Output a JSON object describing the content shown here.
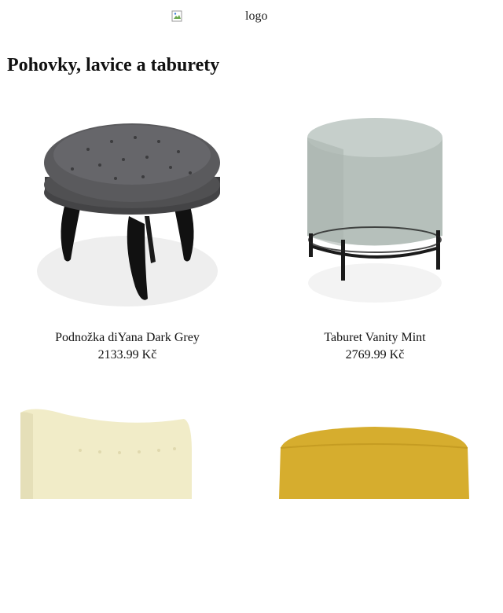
{
  "header": {
    "logo_alt": "logo"
  },
  "page": {
    "title": "Pohovky, lavice a taburety"
  },
  "products": [
    {
      "name": "Podnožka diYana Dark Grey",
      "price": "2133.99 Kč",
      "color": "#4a4a4c"
    },
    {
      "name": "Taburet Vanity Mint",
      "price": "2769.99 Kč",
      "color": "#b8c2bd"
    },
    {
      "name": "",
      "price": "",
      "color": "#f1ecc8"
    },
    {
      "name": "",
      "price": "",
      "color": "#d6ad2e"
    }
  ]
}
